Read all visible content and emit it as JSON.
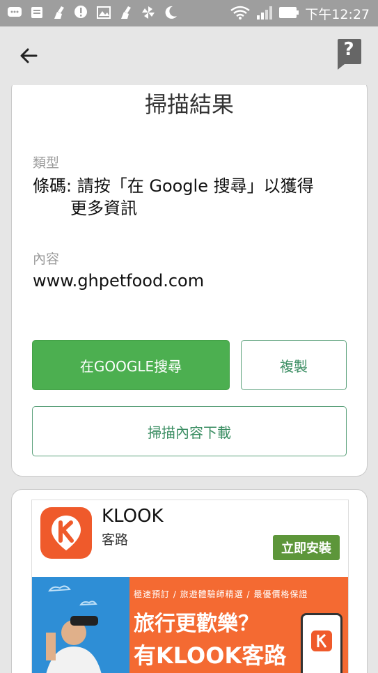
{
  "status_bar": {
    "time": "下午12:27",
    "icons": [
      "chat-icon",
      "news-icon",
      "cleaner-icon",
      "alert-icon",
      "gallery-icon",
      "cleaner-icon",
      "pinwheel-icon",
      "moon-icon",
      "wifi-icon",
      "signal-icon",
      "battery-icon"
    ]
  },
  "app_bar": {
    "back_icon": "arrow-left-icon",
    "help_icon": "help-icon",
    "help_glyph": "?"
  },
  "result_card": {
    "title": "掃描結果",
    "type_label": "類型",
    "type_value_line1": "條碼: 請按「在 Google 搜尋」以獲得",
    "type_value_line2": "更多資訊",
    "content_label": "內容",
    "content_value": "www.ghpetfood.com",
    "search_button": "在GOOGLE搜尋",
    "copy_button": "複製",
    "download_button": "掃描內容下載"
  },
  "ad_card": {
    "app_name": "KLOOK",
    "app_subtitle": "客路",
    "install_button": "立即安裝",
    "banner_tagline": "極速預訂 / 旅遊體驗師精選 / 最優價格保證",
    "banner_headline": "旅行更歡樂？",
    "banner_brand_line": "有KLOOK客路",
    "colors": {
      "brand_orange": "#f46a32",
      "sky_blue": "#2e8ed6",
      "install_green": "#5d963a"
    }
  },
  "colors": {
    "primary_green": "#4caf50",
    "outline_green": "#3b8e63",
    "status_bar": "#9e9e9e"
  }
}
